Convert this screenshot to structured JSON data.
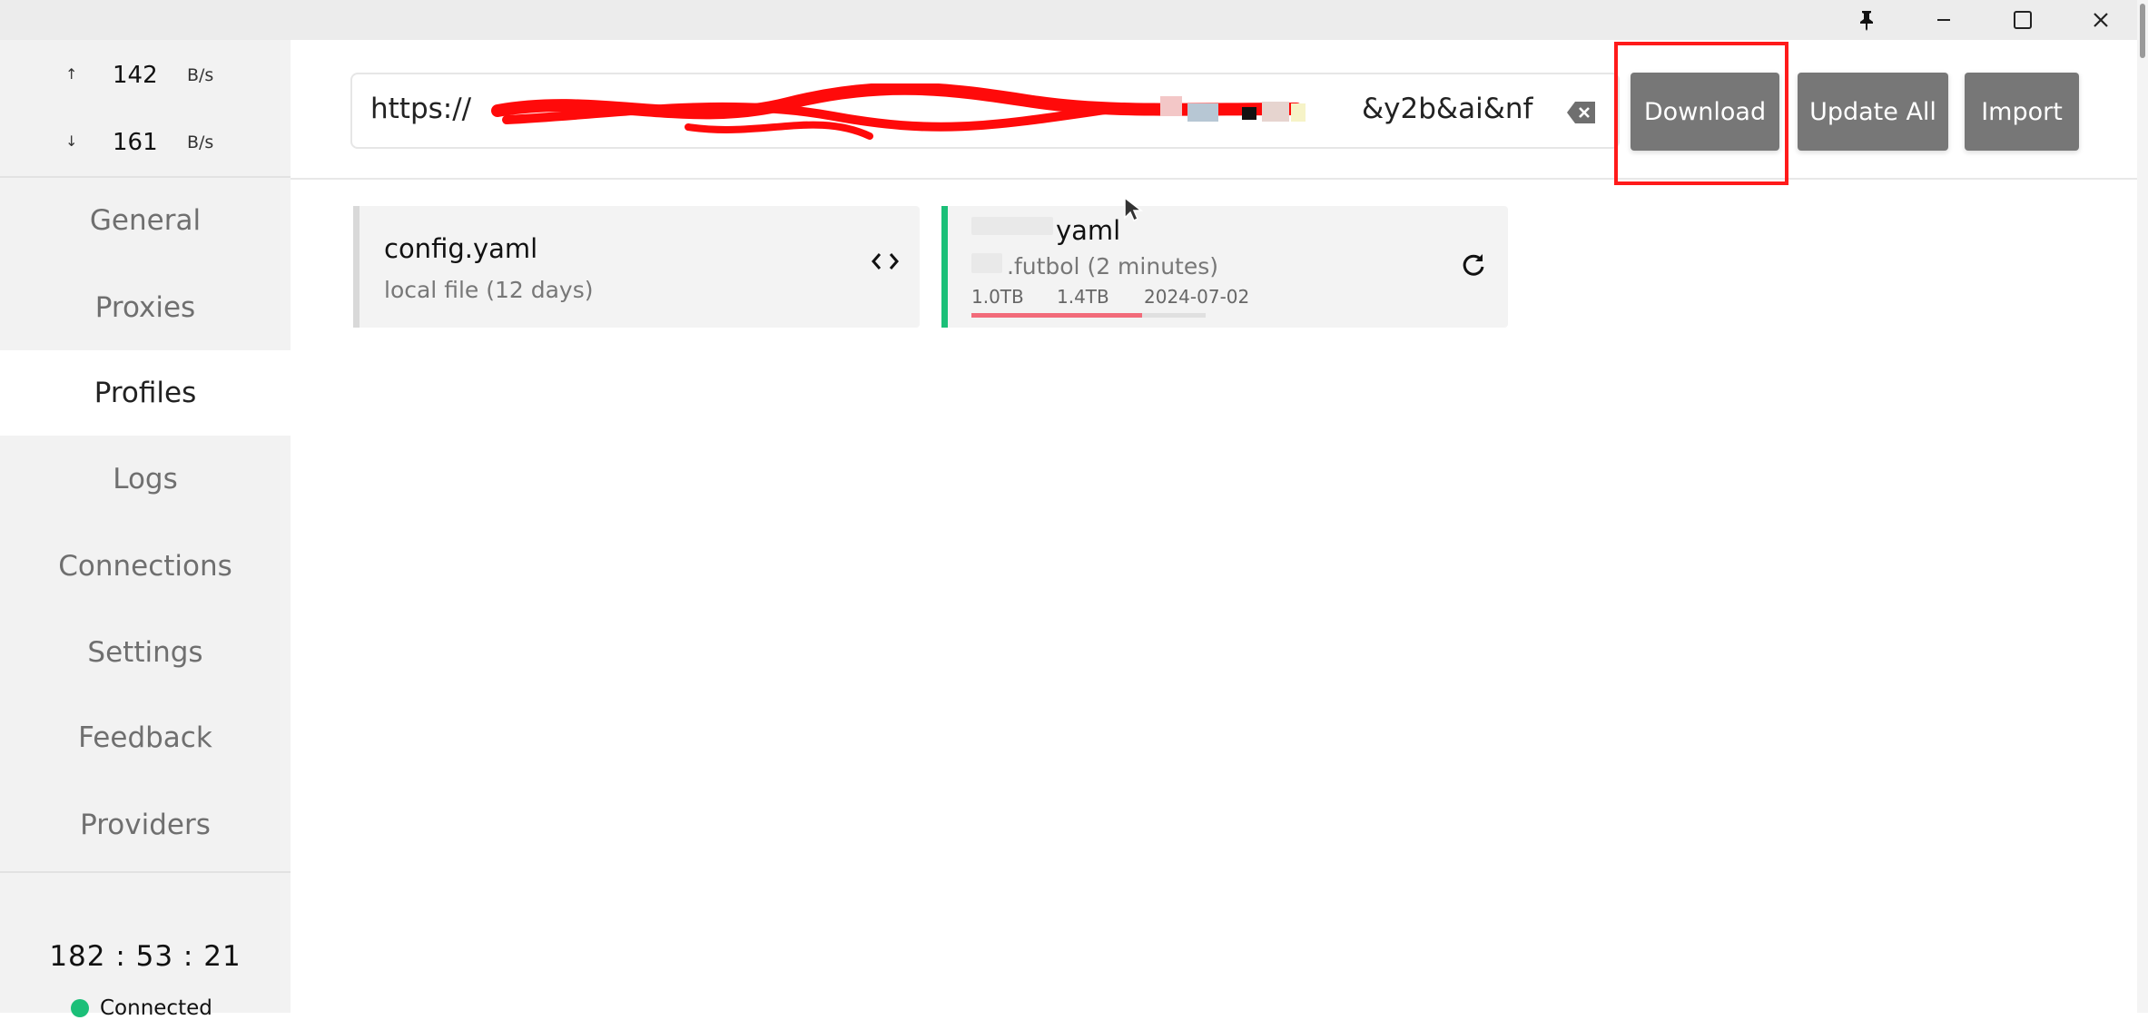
{
  "titlebar": {
    "pin_icon": "pin-icon",
    "minimize_icon": "minimize-icon",
    "maximize_icon": "maximize-icon",
    "close_icon": "close-icon"
  },
  "traffic": {
    "upload": {
      "arrow": "↑",
      "value": "142",
      "unit": "B/s"
    },
    "download": {
      "arrow": "↓",
      "value": "161",
      "unit": "B/s"
    }
  },
  "nav": {
    "items": [
      {
        "label": "General"
      },
      {
        "label": "Proxies"
      },
      {
        "label": "Profiles",
        "active": true
      },
      {
        "label": "Logs"
      },
      {
        "label": "Connections"
      },
      {
        "label": "Settings"
      },
      {
        "label": "Feedback"
      },
      {
        "label": "Providers"
      }
    ]
  },
  "footer": {
    "uptime": "182 : 53 : 21",
    "status": "Connected",
    "status_color": "#1bbf78"
  },
  "header": {
    "url_prefix": "https://",
    "url_suffix": "&y2b&ai&nf",
    "buttons": {
      "download": "Download",
      "update_all": "Update All",
      "import": "Import"
    }
  },
  "profiles": [
    {
      "title": "config.yaml",
      "subtitle": "local file (12 days)",
      "action_icon": "code-icon",
      "accent_color": "#d9d9d9"
    },
    {
      "title": "yaml",
      "subtitle": ".futbol (2 minutes)",
      "action_icon": "refresh-icon",
      "accent_color": "#1bbf78",
      "used": "1.0TB",
      "total": "1.4TB",
      "expire": "2024-07-02",
      "usage_fraction": 0.73
    }
  ],
  "colors": {
    "button_bg": "#777777",
    "highlight": "#ff1a1a",
    "usage_fill": "#f26b7a"
  }
}
